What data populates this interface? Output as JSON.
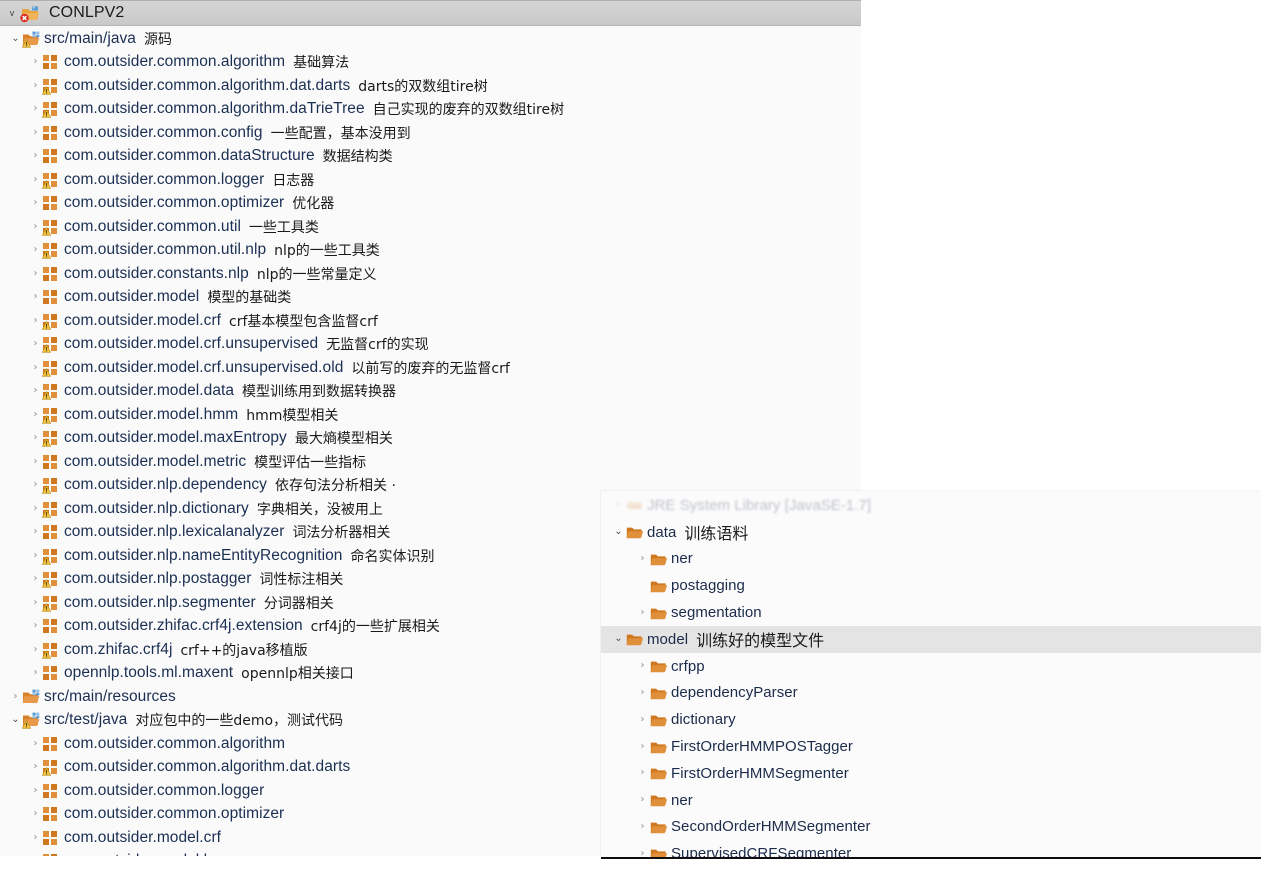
{
  "window": {
    "title": "CONLPV2",
    "title_icon": "project-folder-error-icon",
    "expand_chevron": "v"
  },
  "icons": {
    "chevron_collapsed": "›",
    "chevron_expanded": "⌄"
  },
  "colors": {
    "titlebar_bg": "#d0d0d0",
    "package_orange": "#d98128",
    "folder_orange": "#d98128",
    "label_text": "#1b2b4a",
    "selection_bg": "#e4e4e4",
    "panel_bg": "#fafafa",
    "warning_yellow": "#f3c242",
    "error_red": "#d93025"
  },
  "left_tree": [
    {
      "label": "src/main/java",
      "note": "源码",
      "icon": "src-folder-icon",
      "warn": true,
      "state": "expanded",
      "indent": 0
    },
    {
      "label": "com.outsider.common.algorithm",
      "note": "基础算法",
      "icon": "package-icon",
      "warn": false,
      "state": "collapsed",
      "indent": 1
    },
    {
      "label": "com.outsider.common.algorithm.dat.darts",
      "note": "darts的双数组tire树",
      "icon": "package-icon",
      "warn": true,
      "state": "collapsed",
      "indent": 1
    },
    {
      "label": "com.outsider.common.algorithm.daTrieTree",
      "note": "自己实现的废弃的双数组tire树",
      "icon": "package-icon",
      "warn": true,
      "state": "collapsed",
      "indent": 1
    },
    {
      "label": "com.outsider.common.config",
      "note": "一些配置，基本没用到",
      "icon": "package-icon",
      "warn": false,
      "state": "collapsed",
      "indent": 1
    },
    {
      "label": "com.outsider.common.dataStructure",
      "note": "数据结构类",
      "icon": "package-icon",
      "warn": false,
      "state": "collapsed",
      "indent": 1
    },
    {
      "label": "com.outsider.common.logger",
      "note": "日志器",
      "icon": "package-icon",
      "warn": true,
      "state": "collapsed",
      "indent": 1
    },
    {
      "label": "com.outsider.common.optimizer",
      "note": "优化器",
      "icon": "package-icon",
      "warn": false,
      "state": "collapsed",
      "indent": 1
    },
    {
      "label": "com.outsider.common.util",
      "note": "一些工具类",
      "icon": "package-icon",
      "warn": true,
      "state": "collapsed",
      "indent": 1
    },
    {
      "label": "com.outsider.common.util.nlp",
      "note": "nlp的一些工具类",
      "icon": "package-icon",
      "warn": true,
      "state": "collapsed",
      "indent": 1
    },
    {
      "label": "com.outsider.constants.nlp",
      "note": "nlp的一些常量定义",
      "icon": "package-icon",
      "warn": false,
      "state": "collapsed",
      "indent": 1
    },
    {
      "label": "com.outsider.model",
      "note": "模型的基础类",
      "icon": "package-icon",
      "warn": false,
      "state": "collapsed",
      "indent": 1
    },
    {
      "label": "com.outsider.model.crf",
      "note": "crf基本模型包含监督crf",
      "icon": "package-icon",
      "warn": true,
      "state": "collapsed",
      "indent": 1
    },
    {
      "label": "com.outsider.model.crf.unsupervised",
      "note": "无监督crf的实现",
      "icon": "package-icon",
      "warn": true,
      "state": "collapsed",
      "indent": 1
    },
    {
      "label": "com.outsider.model.crf.unsupervised.old",
      "note": "以前写的废弃的无监督crf",
      "icon": "package-icon",
      "warn": true,
      "state": "collapsed",
      "indent": 1
    },
    {
      "label": "com.outsider.model.data",
      "note": "模型训练用到数据转换器",
      "icon": "package-icon",
      "warn": true,
      "state": "collapsed",
      "indent": 1
    },
    {
      "label": "com.outsider.model.hmm",
      "note": "hmm模型相关",
      "icon": "package-icon",
      "warn": true,
      "state": "collapsed",
      "indent": 1
    },
    {
      "label": "com.outsider.model.maxEntropy",
      "note": "最大熵模型相关",
      "icon": "package-icon",
      "warn": true,
      "state": "collapsed",
      "indent": 1
    },
    {
      "label": "com.outsider.model.metric",
      "note": "模型评估一些指标",
      "icon": "package-icon",
      "warn": false,
      "state": "collapsed",
      "indent": 1
    },
    {
      "label": "com.outsider.nlp.dependency",
      "note": "依存句法分析相关 ·",
      "icon": "package-icon",
      "warn": true,
      "state": "collapsed",
      "indent": 1
    },
    {
      "label": "com.outsider.nlp.dictionary",
      "note": "字典相关，没被用上",
      "icon": "package-icon",
      "warn": true,
      "state": "collapsed",
      "indent": 1
    },
    {
      "label": "com.outsider.nlp.lexicalanalyzer",
      "note": "词法分析器相关",
      "icon": "package-icon",
      "warn": false,
      "state": "collapsed",
      "indent": 1
    },
    {
      "label": "com.outsider.nlp.nameEntityRecognition",
      "note": "命名实体识别",
      "icon": "package-icon",
      "warn": true,
      "state": "collapsed",
      "indent": 1
    },
    {
      "label": "com.outsider.nlp.postagger",
      "note": "词性标注相关",
      "icon": "package-icon",
      "warn": true,
      "state": "collapsed",
      "indent": 1
    },
    {
      "label": "com.outsider.nlp.segmenter",
      "note": "分词器相关",
      "icon": "package-icon",
      "warn": true,
      "state": "collapsed",
      "indent": 1
    },
    {
      "label": "com.outsider.zhifac.crf4j.extension",
      "note": "crf4j的一些扩展相关",
      "icon": "package-icon",
      "warn": false,
      "state": "collapsed",
      "indent": 1
    },
    {
      "label": "com.zhifac.crf4j",
      "note": "crf++的java移植版",
      "icon": "package-icon",
      "warn": true,
      "state": "collapsed",
      "indent": 1
    },
    {
      "label": "opennlp.tools.ml.maxent",
      "note": "opennlp相关接口",
      "icon": "package-icon",
      "warn": false,
      "state": "collapsed",
      "indent": 1
    },
    {
      "label": "src/main/resources",
      "note": "",
      "icon": "src-folder-icon",
      "warn": false,
      "state": "collapsed",
      "indent": 0
    },
    {
      "label": "src/test/java",
      "note": "对应包中的一些demo，测试代码",
      "icon": "src-folder-icon",
      "warn": true,
      "state": "expanded",
      "indent": 0
    },
    {
      "label": "com.outsider.common.algorithm",
      "note": "",
      "icon": "package-icon",
      "warn": false,
      "state": "collapsed",
      "indent": 1
    },
    {
      "label": "com.outsider.common.algorithm.dat.darts",
      "note": "",
      "icon": "package-icon",
      "warn": true,
      "state": "collapsed",
      "indent": 1
    },
    {
      "label": "com.outsider.common.logger",
      "note": "",
      "icon": "package-icon",
      "warn": false,
      "state": "collapsed",
      "indent": 1
    },
    {
      "label": "com.outsider.common.optimizer",
      "note": "",
      "icon": "package-icon",
      "warn": false,
      "state": "collapsed",
      "indent": 1
    },
    {
      "label": "com.outsider.model.crf",
      "note": "",
      "icon": "package-icon",
      "warn": false,
      "state": "collapsed",
      "indent": 1
    },
    {
      "label": "com.outsider.model.hmm",
      "note": "",
      "icon": "package-icon",
      "warn": true,
      "state": "collapsed",
      "indent": 1
    }
  ],
  "right_tree": [
    {
      "label": "JRE System Library [JavaSE-1.7]",
      "note": "",
      "icon": "library-icon",
      "state": "collapsed",
      "indent": 0,
      "clipped": true,
      "selected": false
    },
    {
      "label": "data",
      "note": "训练语料",
      "icon": "folder-icon",
      "state": "expanded",
      "indent": 0,
      "clipped": false,
      "selected": false
    },
    {
      "label": "ner",
      "note": "",
      "icon": "folder-icon",
      "state": "collapsed",
      "indent": 1,
      "clipped": false,
      "selected": false
    },
    {
      "label": "postagging",
      "note": "",
      "icon": "folder-icon",
      "state": "leaf",
      "indent": 1,
      "clipped": false,
      "selected": false
    },
    {
      "label": "segmentation",
      "note": "",
      "icon": "folder-icon",
      "state": "collapsed",
      "indent": 1,
      "clipped": false,
      "selected": false
    },
    {
      "label": "model",
      "note": "训练好的模型文件",
      "icon": "folder-icon",
      "state": "expanded",
      "indent": 0,
      "clipped": false,
      "selected": true
    },
    {
      "label": "crfpp",
      "note": "",
      "icon": "folder-icon",
      "state": "collapsed",
      "indent": 1,
      "clipped": false,
      "selected": false
    },
    {
      "label": "dependencyParser",
      "note": "",
      "icon": "folder-icon",
      "state": "collapsed",
      "indent": 1,
      "clipped": false,
      "selected": false
    },
    {
      "label": "dictionary",
      "note": "",
      "icon": "folder-icon",
      "state": "collapsed",
      "indent": 1,
      "clipped": false,
      "selected": false
    },
    {
      "label": "FirstOrderHMMPOSTagger",
      "note": "",
      "icon": "folder-icon",
      "state": "collapsed",
      "indent": 1,
      "clipped": false,
      "selected": false
    },
    {
      "label": "FirstOrderHMMSegmenter",
      "note": "",
      "icon": "folder-icon",
      "state": "collapsed",
      "indent": 1,
      "clipped": false,
      "selected": false
    },
    {
      "label": "ner",
      "note": "",
      "icon": "folder-icon",
      "state": "collapsed",
      "indent": 1,
      "clipped": false,
      "selected": false
    },
    {
      "label": "SecondOrderHMMSegmenter",
      "note": "",
      "icon": "folder-icon",
      "state": "collapsed",
      "indent": 1,
      "clipped": false,
      "selected": false
    },
    {
      "label": "SupervisedCRFSegmenter",
      "note": "",
      "icon": "folder-icon",
      "state": "collapsed",
      "indent": 1,
      "clipped": false,
      "selected": false
    }
  ]
}
